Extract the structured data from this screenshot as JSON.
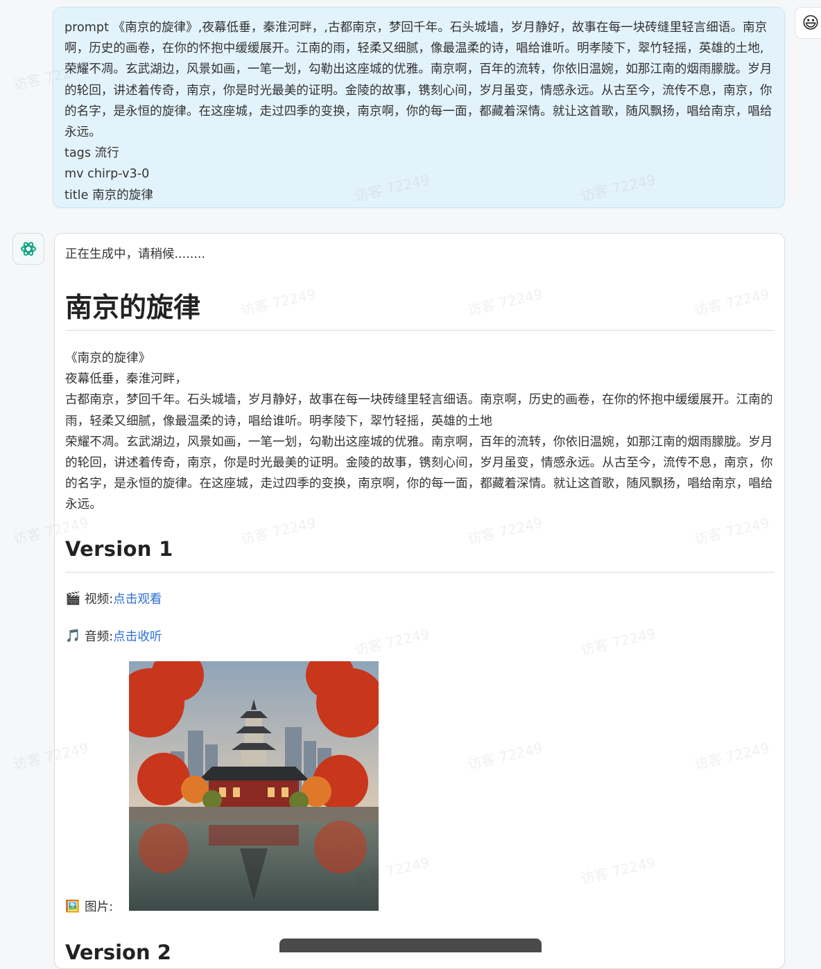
{
  "user_message": {
    "prompt_line": "prompt 《南京的旋律》,夜幕低垂，秦淮河畔，,古都南京，梦回千年。石头城墙，岁月静好，故事在每一块砖缝里轻言细语。南京啊，历史的画卷，在你的怀抱中缓缓展开。江南的雨，轻柔又细腻，像最温柔的诗，唱给谁听。明孝陵下，翠竹轻摇，英雄的土地,荣耀不凋。玄武湖边，风景如画，一笔一划，勾勒出这座城的优雅。南京啊，百年的流转，你依旧温婉，如那江南的烟雨朦胧。岁月的轮回，讲述着传奇，南京，你是时光最美的证明。金陵的故事，镌刻心间，岁月虽变，情感永远。从古至今，流传不息，南京，你的名字，是永恒的旋律。在这座城，走过四季的变换，南京啊，你的每一面，都藏着深情。就让这首歌，随风飘扬，唱给南京，唱给永远。",
    "tags_line": "tags 流行",
    "mv_line": "mv chirp-v3-0",
    "title_line": "title 南京的旋律"
  },
  "assistant": {
    "status": "正在生成中，请稍候........",
    "song_title": "南京的旋律",
    "lyrics": [
      "《南京的旋律》",
      "夜幕低垂，秦淮河畔，",
      "古都南京，梦回千年。石头城墙，岁月静好，故事在每一块砖缝里轻言细语。南京啊，历史的画卷，在你的怀抱中缓缓展开。江南的雨，轻柔又细腻，像最温柔的诗，唱给谁听。明孝陵下，翠竹轻摇，英雄的土地",
      "荣耀不凋。玄武湖边，风景如画，一笔一划，勾勒出这座城的优雅。南京啊，百年的流转，你依旧温婉，如那江南的烟雨朦胧。岁月的轮回，讲述着传奇，南京，你是时光最美的证明。金陵的故事，镌刻心间，岁月虽变，情感永远。从古至今，流传不息，南京，你的名字，是永恒的旋律。在这座城，走过四季的变换，南京啊，你的每一面，都藏着深情。就让这首歌，随风飘扬，唱给南京，唱给永远。"
    ],
    "version_heading": "Version 1",
    "video": {
      "emoji": "🎬",
      "label": "视频:",
      "link": "点击观看"
    },
    "audio": {
      "emoji": "🎵",
      "label": "音频:",
      "link": "点击收听"
    },
    "image": {
      "emoji": "🖼️",
      "label": "图片:",
      "alt": "南京的旋律"
    },
    "next_heading": "Version 2"
  },
  "watermark": "访客 72249",
  "icons": {
    "user_avatar": "smiley-face-icon",
    "bot_avatar": "openai-logo-icon"
  },
  "colors": {
    "user_bubble": "#e3f3fc",
    "link": "#2c6fd6"
  }
}
